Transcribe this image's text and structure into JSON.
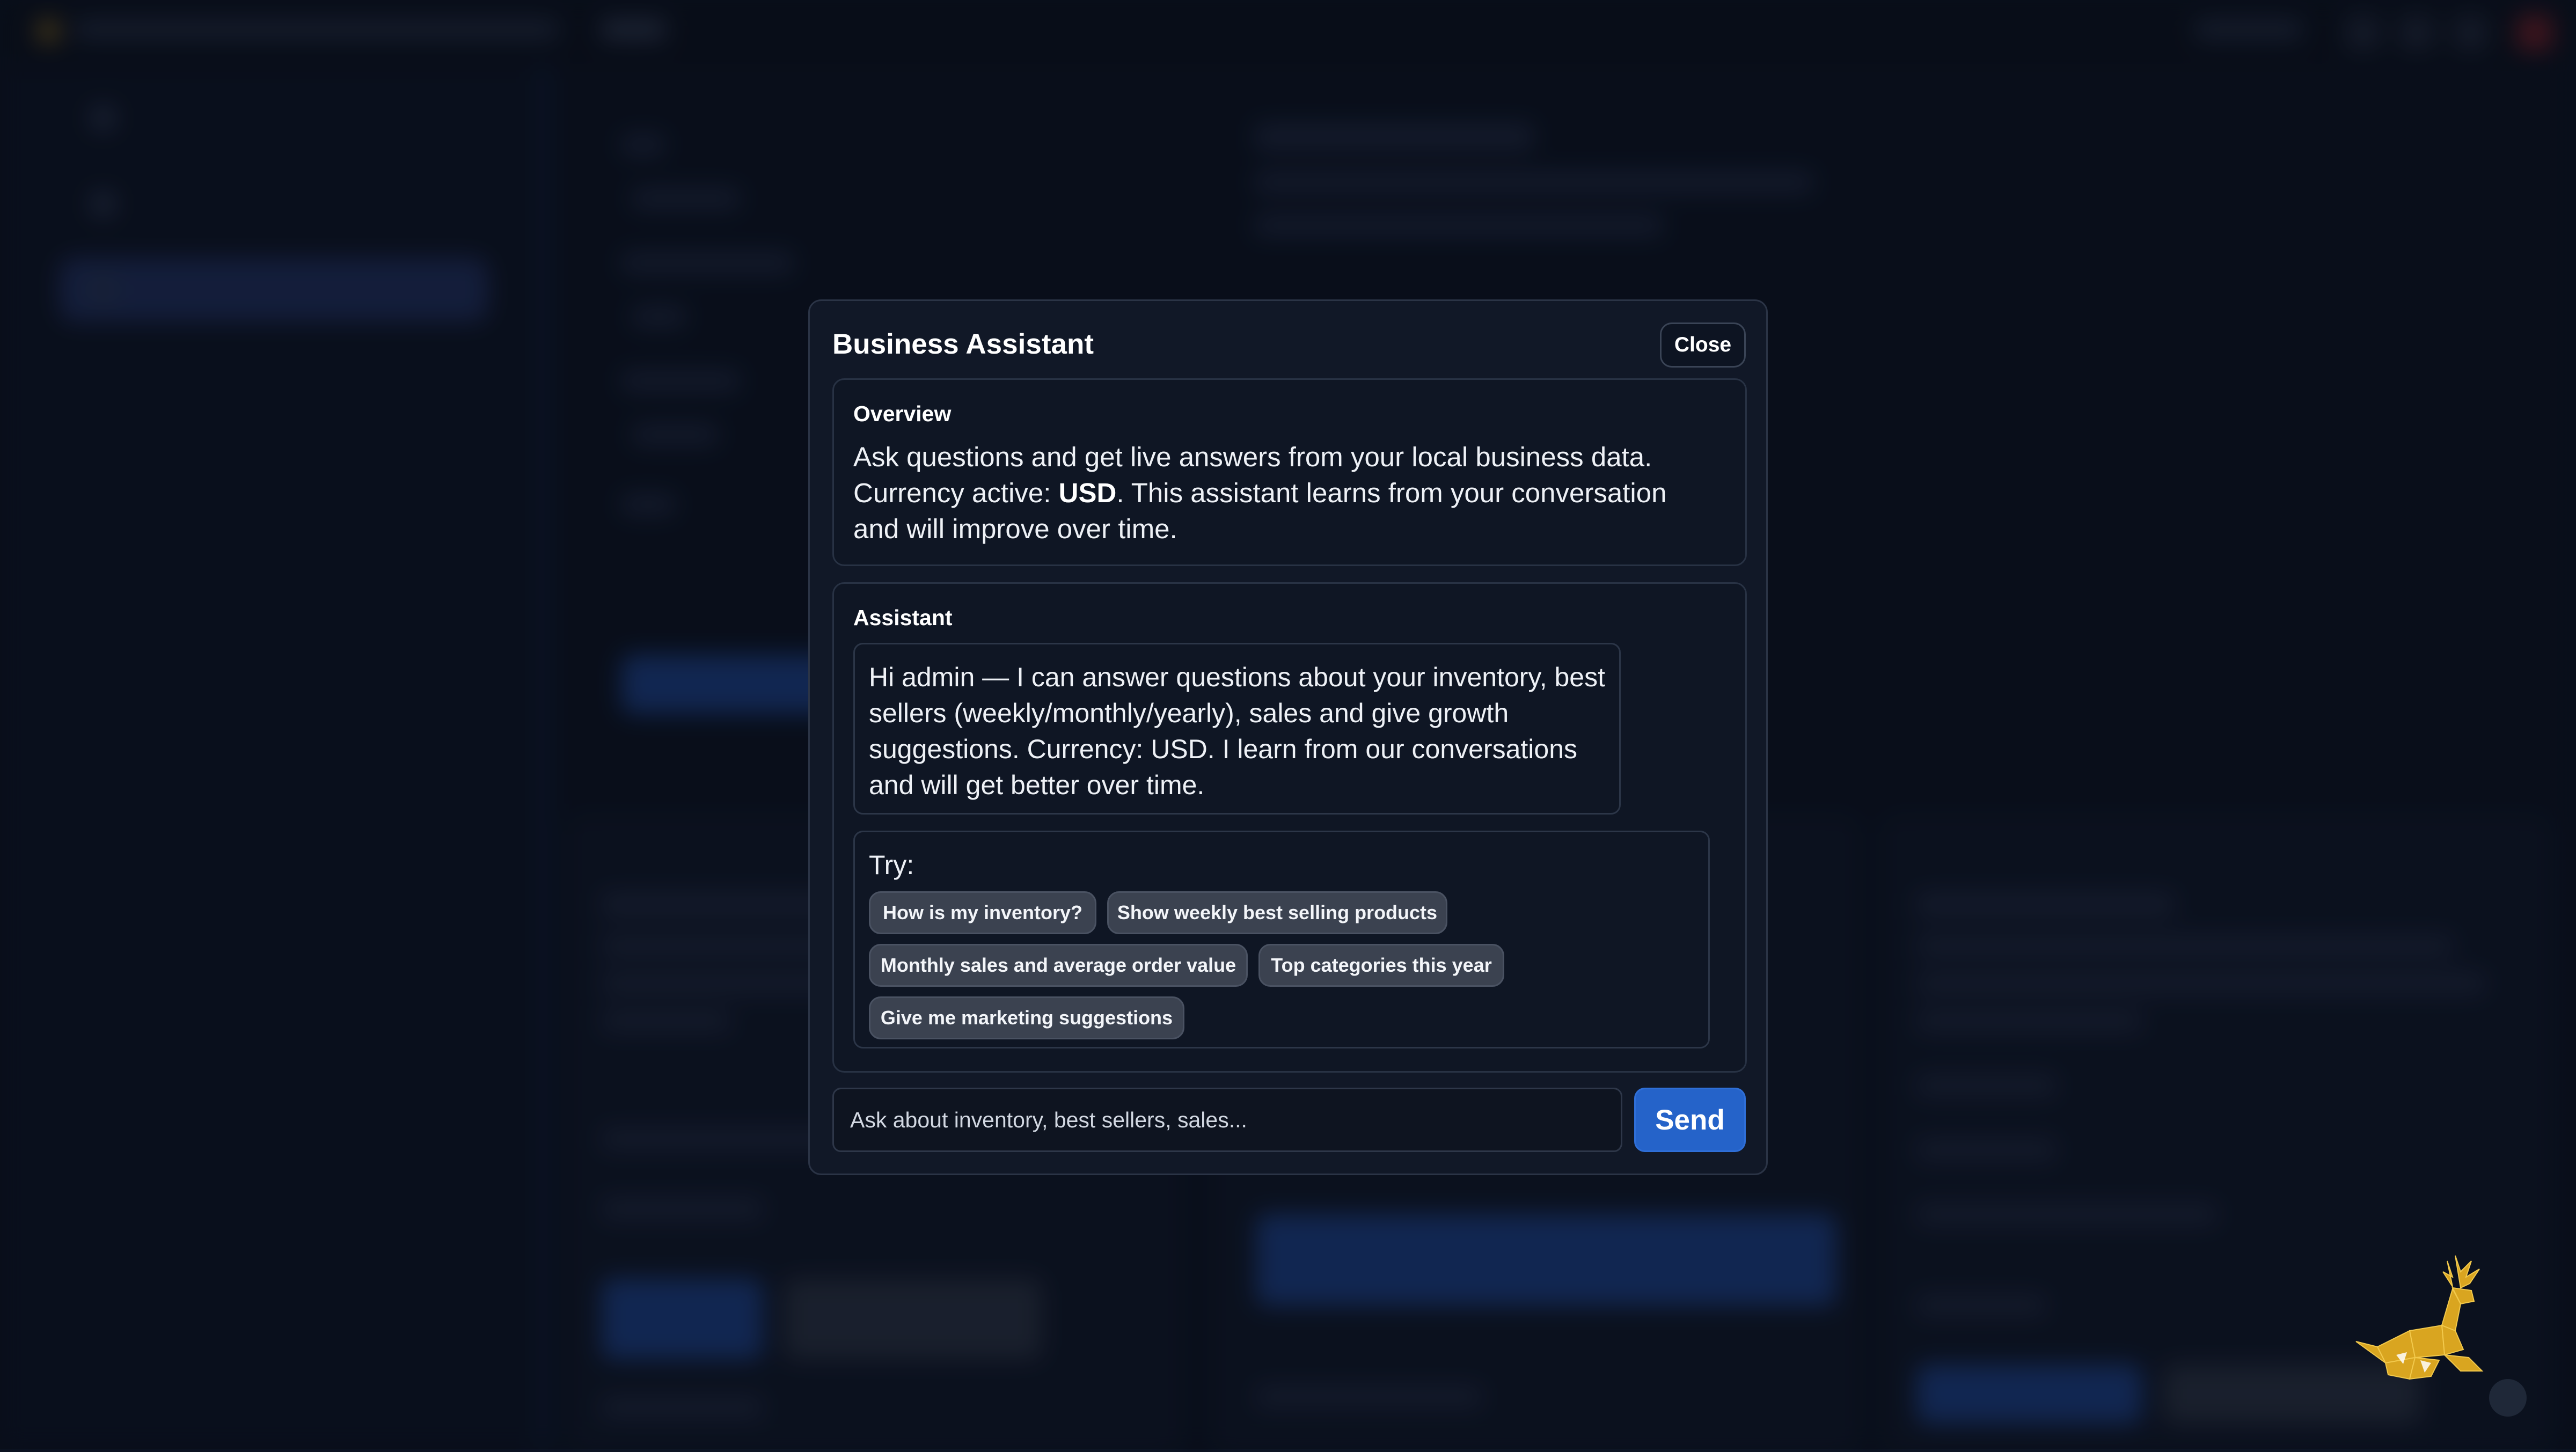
{
  "modal": {
    "title": "Business Assistant",
    "close_label": "Close",
    "overview": {
      "heading": "Overview",
      "text_before": "Ask questions and get live answers from your local business data. Currency active: ",
      "currency": "USD",
      "text_after": ". This assistant learns from your conversation and will improve over time."
    },
    "assistant": {
      "heading": "Assistant",
      "message": "Hi admin — I can answer questions about your inventory, best sellers (weekly/monthly/yearly), sales and give growth suggestions. Currency: USD. I learn from our conversations and will get better over time.",
      "try_label": "Try:",
      "suggestions": [
        "How is my inventory?",
        "Show weekly best selling products",
        "Monthly sales and average order value",
        "Top categories this year",
        "Give me marketing suggestions"
      ]
    },
    "input": {
      "placeholder": "Ask about inventory, best sellers, sales...",
      "value": ""
    },
    "send_label": "Send"
  },
  "colors": {
    "accent": "#2563c9",
    "background": "#0b1220",
    "modal_bg": "#111827",
    "logo_gold": "#d9a520"
  }
}
